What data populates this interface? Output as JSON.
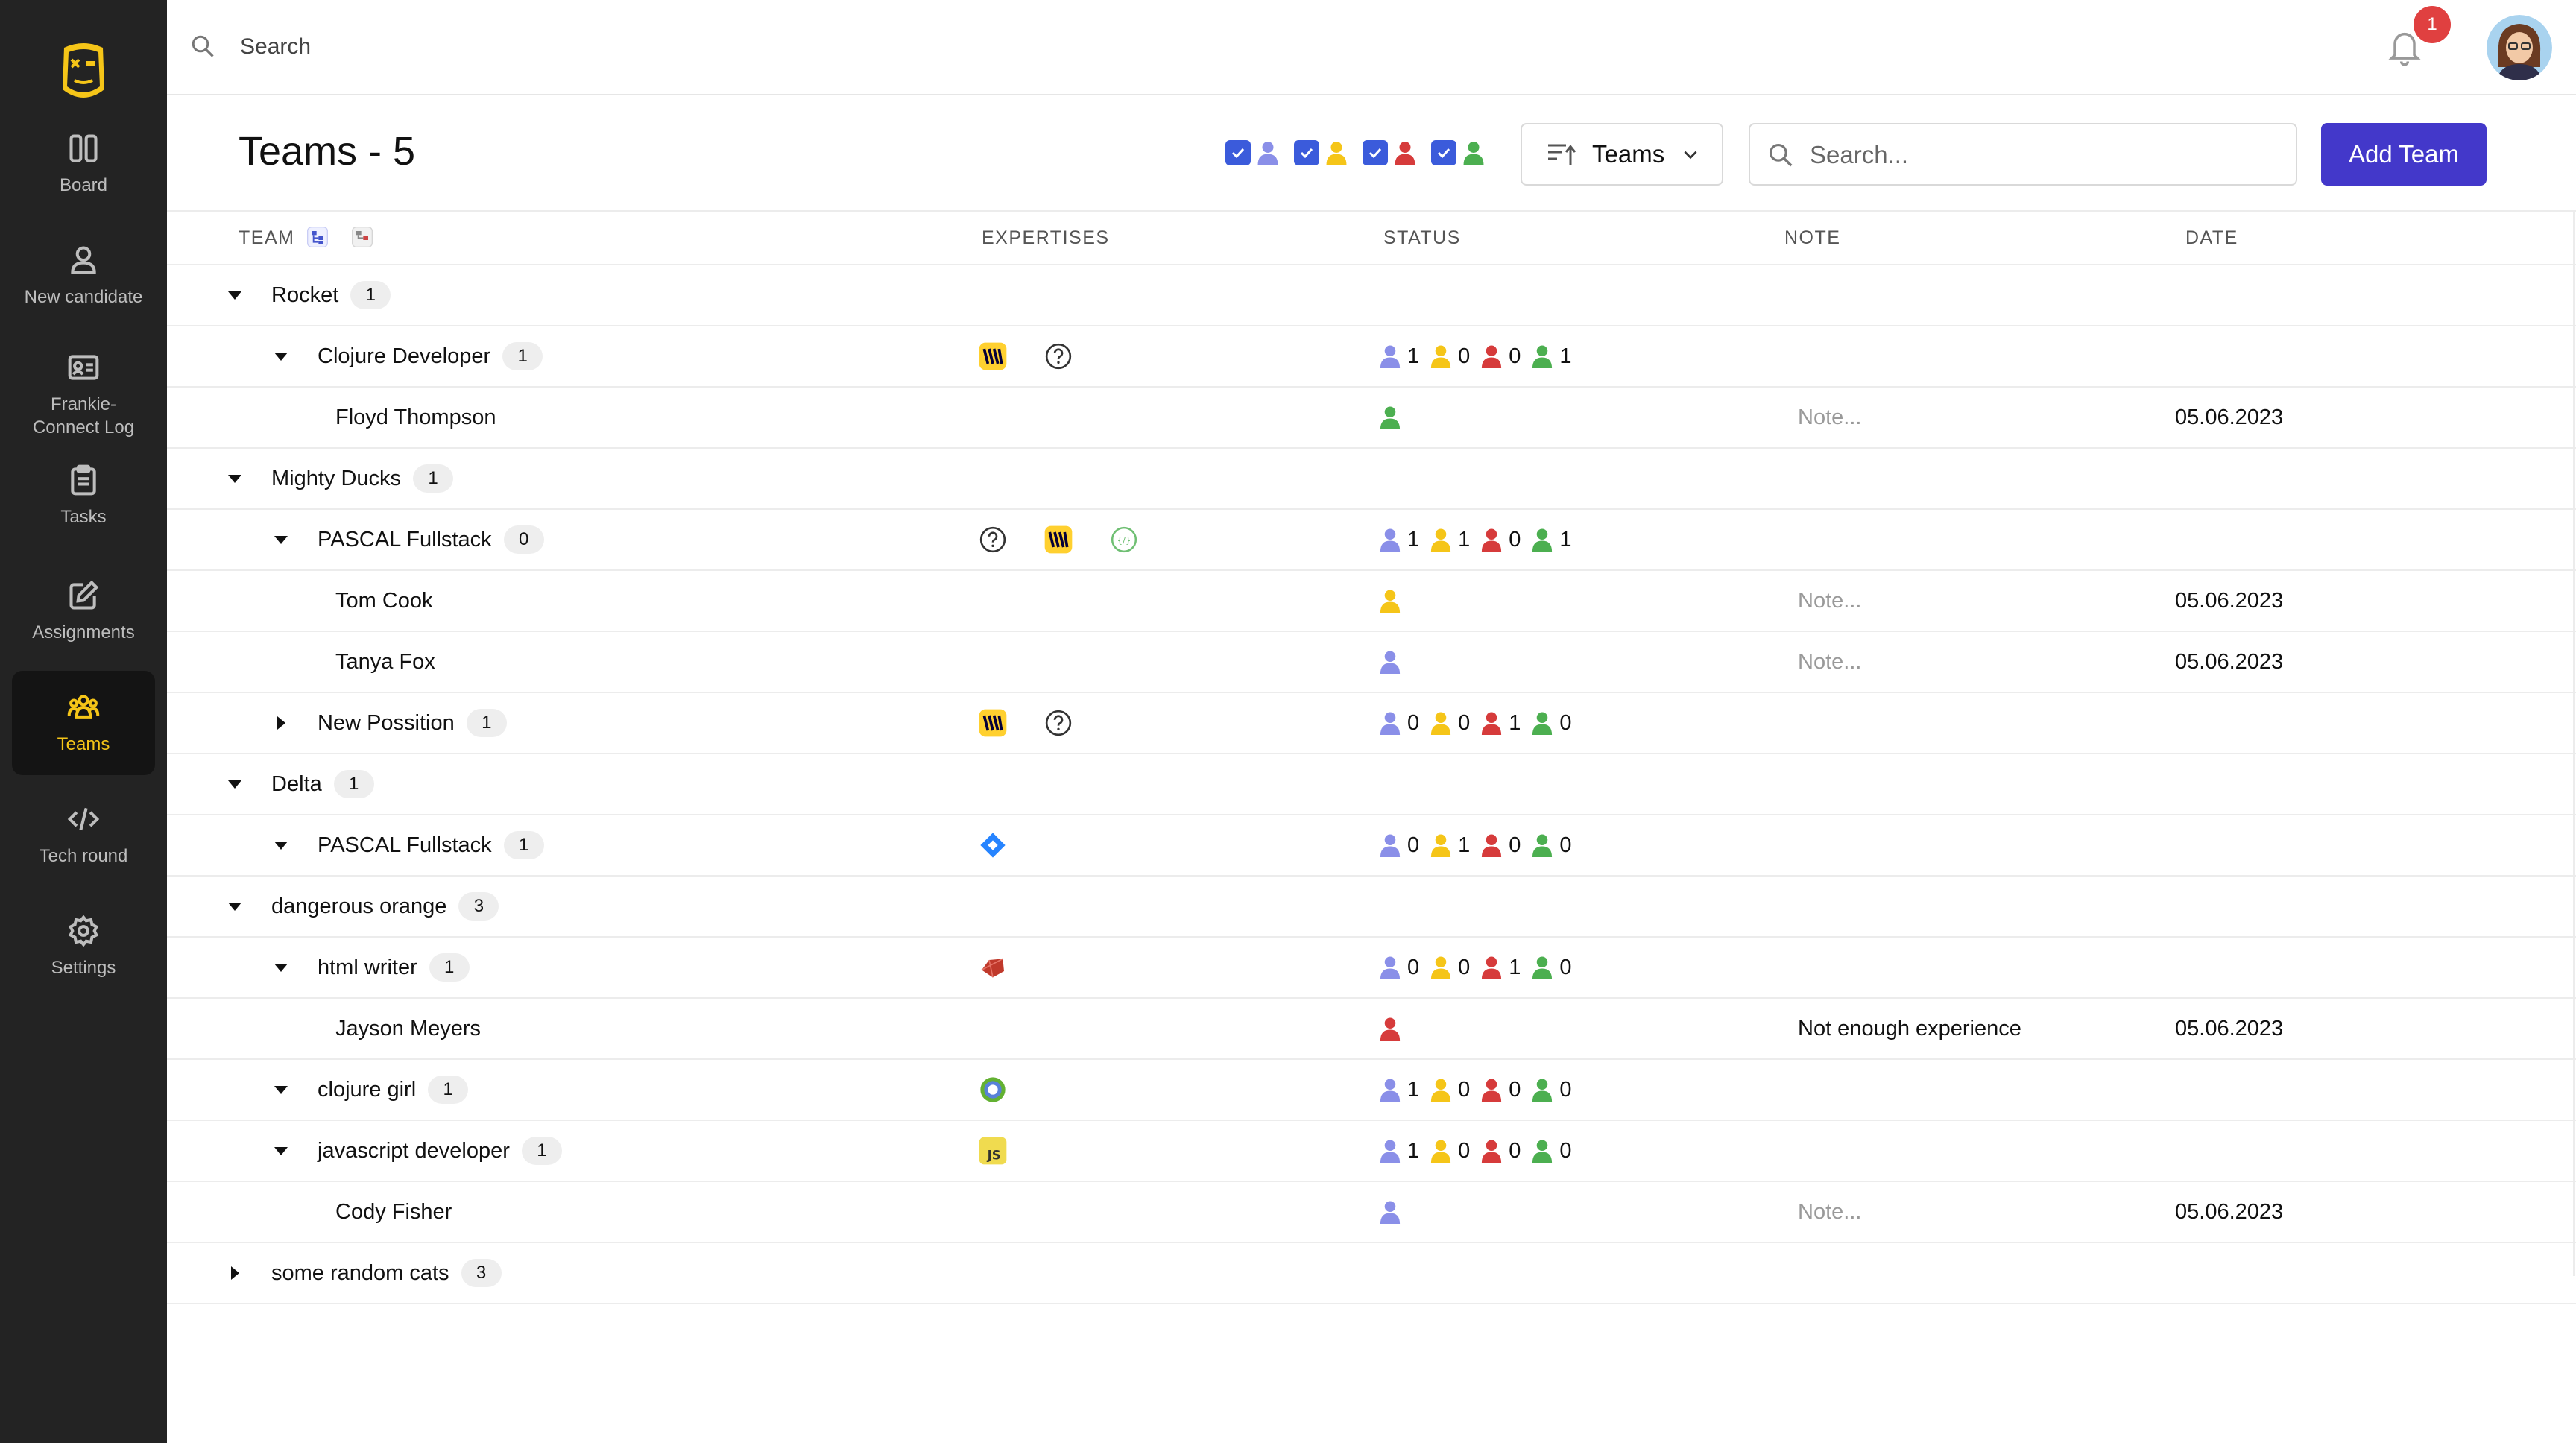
{
  "topbar": {
    "search_placeholder": "Search",
    "notification_count": "1"
  },
  "sidebar": {
    "items": [
      {
        "label": "Board",
        "icon": "board-icon"
      },
      {
        "label": "New candidate",
        "icon": "user-icon"
      },
      {
        "label": "Frankie-\nConnect Log",
        "icon": "id-card-icon"
      },
      {
        "label": "Tasks",
        "icon": "clipboard-icon"
      },
      {
        "label": "Assignments",
        "icon": "edit-icon"
      },
      {
        "label": "Teams",
        "icon": "team-icon",
        "active": true
      },
      {
        "label": "Tech round",
        "icon": "code-icon"
      },
      {
        "label": "Settings",
        "icon": "gear-icon"
      }
    ]
  },
  "header": {
    "title": "Teams - 5",
    "sort_label": "Teams",
    "search_placeholder": "Search...",
    "add_button": "Add Team",
    "filter_colors": [
      "#8a8fe8",
      "#f5c518",
      "#d63b3b",
      "#4caf50"
    ]
  },
  "columns": {
    "team": "TEAM",
    "expertises": "EXPERTISES",
    "status": "STATUS",
    "note": "NOTE",
    "date": "DATE"
  },
  "colors": {
    "blue": "#8a8fe8",
    "yellow": "#f5c518",
    "red": "#d63b3b",
    "green": "#4caf50",
    "accent": "#4338ca",
    "checkbox": "#3b5bdb"
  },
  "rows": [
    {
      "level": 0,
      "name": "Rocket",
      "count": "1",
      "expanded": true
    },
    {
      "level": 1,
      "name": "Clojure Developer",
      "count": "1",
      "expanded": true,
      "expertises": [
        "miro-icon",
        "question-icon"
      ],
      "status": [
        "1",
        "0",
        "0",
        "1"
      ]
    },
    {
      "level": 2,
      "name": "Floyd Thompson",
      "person": "green",
      "note": "Note...",
      "date": "05.06.2023"
    },
    {
      "level": 0,
      "name": "Mighty Ducks",
      "count": "1",
      "expanded": true
    },
    {
      "level": 1,
      "name": "PASCAL Fullstack",
      "count": "0",
      "expanded": true,
      "expertises": [
        "question-icon",
        "miro-icon",
        "api-icon"
      ],
      "status": [
        "1",
        "1",
        "0",
        "1"
      ]
    },
    {
      "level": 2,
      "name": "Tom Cook",
      "person": "yellow",
      "note": "Note...",
      "date": "05.06.2023"
    },
    {
      "level": 2,
      "name": "Tanya Fox",
      "person": "blue",
      "note": "Note...",
      "date": "05.06.2023"
    },
    {
      "level": 1,
      "name": "New Possition",
      "count": "1",
      "expanded": false,
      "expertises": [
        "miro-icon",
        "question-icon"
      ],
      "status": [
        "0",
        "0",
        "1",
        "0"
      ]
    },
    {
      "level": 0,
      "name": "Delta",
      "count": "1",
      "expanded": true
    },
    {
      "level": 1,
      "name": "PASCAL Fullstack",
      "count": "1",
      "expanded": true,
      "expertises": [
        "jira-icon"
      ],
      "status": [
        "0",
        "1",
        "0",
        "0"
      ]
    },
    {
      "level": 0,
      "name": "dangerous orange",
      "count": "3",
      "expanded": true
    },
    {
      "level": 1,
      "name": "html writer",
      "count": "1",
      "expanded": true,
      "expertises": [
        "ruby-icon"
      ],
      "status": [
        "0",
        "0",
        "1",
        "0"
      ]
    },
    {
      "level": 2,
      "name": "Jayson Meyers",
      "person": "red",
      "note": "Not enough experience",
      "date": "05.06.2023"
    },
    {
      "level": 1,
      "name": "clojure girl",
      "count": "1",
      "expanded": true,
      "expertises": [
        "clojure-icon"
      ],
      "status": [
        "1",
        "0",
        "0",
        "0"
      ]
    },
    {
      "level": 1,
      "name": "javascript developer",
      "count": "1",
      "expanded": true,
      "expertises": [
        "javascript-icon"
      ],
      "status": [
        "1",
        "0",
        "0",
        "0"
      ]
    },
    {
      "level": 2,
      "name": "Cody Fisher",
      "person": "blue",
      "note": "Note...",
      "date": "05.06.2023"
    },
    {
      "level": 0,
      "name": "some random cats",
      "count": "3",
      "expanded": false
    }
  ]
}
